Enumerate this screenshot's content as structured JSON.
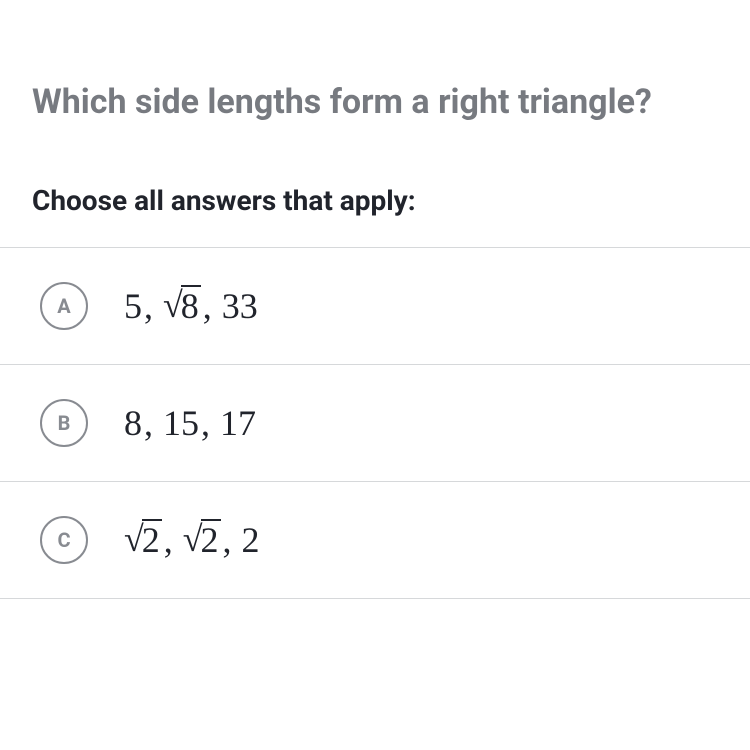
{
  "question": "Which side lengths form a right triangle?",
  "instruction": "Choose all answers that apply:",
  "options": [
    {
      "letter": "A",
      "parts": [
        {
          "type": "num",
          "value": "5"
        },
        {
          "type": "comma",
          "value": ","
        },
        {
          "type": "sqrt",
          "value": "8"
        },
        {
          "type": "comma",
          "value": ","
        },
        {
          "type": "num",
          "value": "33"
        }
      ]
    },
    {
      "letter": "B",
      "parts": [
        {
          "type": "num",
          "value": "8"
        },
        {
          "type": "comma",
          "value": ","
        },
        {
          "type": "num",
          "value": "15"
        },
        {
          "type": "comma",
          "value": ","
        },
        {
          "type": "num",
          "value": "17"
        }
      ]
    },
    {
      "letter": "C",
      "parts": [
        {
          "type": "sqrt",
          "value": "2"
        },
        {
          "type": "comma",
          "value": ","
        },
        {
          "type": "sqrt",
          "value": "2"
        },
        {
          "type": "comma",
          "value": ","
        },
        {
          "type": "num",
          "value": "2"
        }
      ]
    }
  ]
}
